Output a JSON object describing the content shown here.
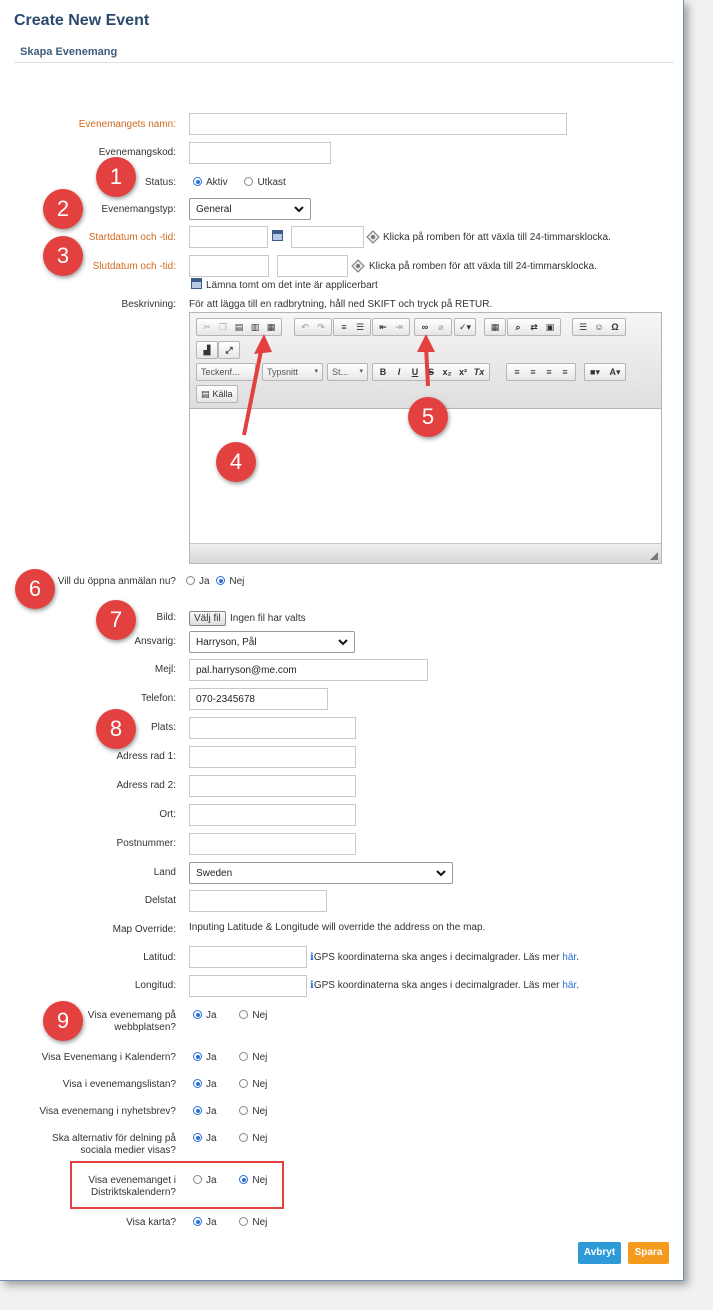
{
  "header": {
    "title": "Create New Event",
    "subtitle": "Skapa Evenemang"
  },
  "form": {
    "name_label": "Evenemangets namn:",
    "code_label": "Evenemangskod:",
    "status_label": "Status:",
    "status_opt1": "Aktiv",
    "status_opt2": "Utkast",
    "type_label": "Evenemangstyp:",
    "type_value": "General",
    "start_label": "Startdatum och -tid:",
    "end_label": "Slutdatum och -tid:",
    "time_hint": "Klicka på romben för att växla till 24-timmarsklocka.",
    "leave_empty_hint": "Lämna tomt om det inte är applicerbart",
    "desc_label": "Beskrivning:",
    "desc_hint": "För att lägga till en radbrytning, håll ned SKIFT och tryck på RETUR.",
    "registration_label": "Vill du öppna anmälan nu?",
    "yes": "Ja",
    "no": "Nej",
    "image_label": "Bild:",
    "file_button": "Välj fil",
    "file_status": "Ingen fil har valts",
    "responsible_label": "Ansvarig:",
    "responsible_value": "Harryson, Pål",
    "email_label": "Mejl:",
    "email_value": "pal.harryson@me.com",
    "phone_label": "Telefon:",
    "phone_value": "070-2345678",
    "place_label": "Plats:",
    "address1_label": "Adress rad 1:",
    "address2_label": "Adress rad 2:",
    "city_label": "Ort:",
    "zip_label": "Postnummer:",
    "country_label": "Land",
    "country_value": "Sweden",
    "state_label": "Delstat",
    "map_override_label": "Map Override:",
    "map_override_hint": "Inputing Latitude & Longitude will override the address on the map.",
    "lat_label": "Latitud:",
    "lon_label": "Longitud:",
    "gps_hint": "GPS koordinaterna ska anges i decimalgrader. Läs mer ",
    "gps_link": "här",
    "show_web_label_1": "Visa evenemang på",
    "show_web_label_2": "webbplatsen?",
    "show_calendar_label": "Visa Evenemang i Kalendern?",
    "show_list_label": "Visa i evenemangslistan?",
    "show_newsletter_label": "Visa evenemang i nyhetsbrev?",
    "share_label_1": "Ska alternativ för delning på",
    "share_label_2": "sociala medier visas?",
    "district_label_1": "Visa evenemanget i",
    "district_label_2": "Distriktskalendern?",
    "map_label": "Visa karta?",
    "cancel_button": "Avbryt",
    "save_button": "Spara"
  },
  "editor": {
    "font_format": "Teckenf...",
    "font_family": "Typsnitt",
    "font_size": "St...",
    "source_button": "Källa"
  },
  "annotations": [
    "1",
    "2",
    "3",
    "4",
    "5",
    "6",
    "7",
    "8",
    "9"
  ],
  "colors": {
    "title": "#2b4a6b",
    "required_label": "#d2691e",
    "badge": "#e34040",
    "cancel": "#2e9ad8",
    "save": "#f39a1f",
    "radio": "#2a6fd6"
  }
}
